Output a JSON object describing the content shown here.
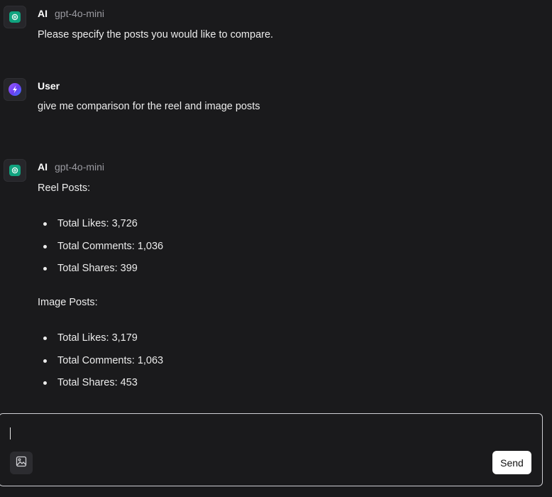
{
  "messages": [
    {
      "sender": "AI",
      "model": "gpt-4o-mini",
      "avatar_icon": "openai-icon",
      "text": "Please specify the posts you would like to compare."
    },
    {
      "sender": "User",
      "avatar_icon": "user-avatar-icon",
      "text": "give me comparison for the reel and image posts"
    },
    {
      "sender": "AI",
      "model": "gpt-4o-mini",
      "avatar_icon": "openai-icon",
      "sections": [
        {
          "heading": "Reel Posts:",
          "items": [
            "Total Likes: 3,726",
            "Total Comments: 1,036",
            "Total Shares: 399"
          ]
        },
        {
          "heading": "Image Posts:",
          "items": [
            "Total Likes: 3,179",
            "Total Comments: 1,063",
            "Total Shares: 453"
          ]
        }
      ]
    }
  ],
  "composer": {
    "input_value": "",
    "image_icon": "image-icon",
    "send_label": "Send"
  },
  "colors": {
    "background": "#1a1a1c",
    "ai_accent": "#10a37f",
    "text": "#ececec",
    "muted": "#9a9aa0"
  }
}
